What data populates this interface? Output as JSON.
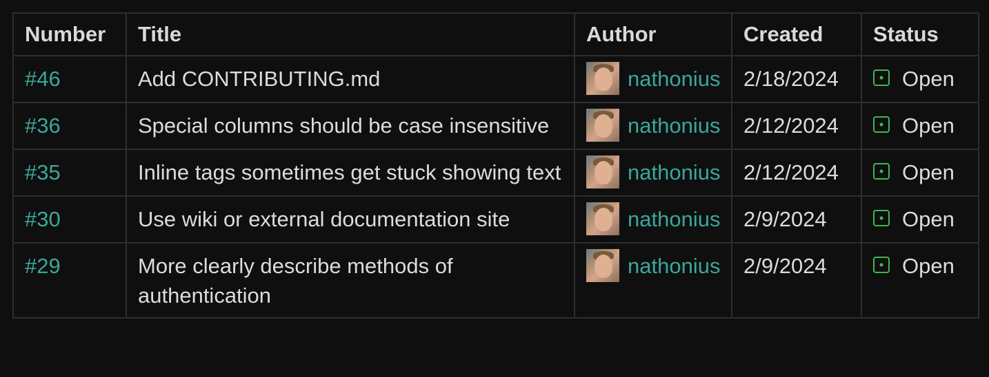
{
  "columns": [
    "Number",
    "Title",
    "Author",
    "Created",
    "Status"
  ],
  "rows": [
    {
      "number": "#46",
      "title": "Add CONTRIBUTING.md",
      "author": "nathonius",
      "created": "2/18/2024",
      "status": "Open"
    },
    {
      "number": "#36",
      "title": "Special columns should be case insensitive",
      "author": "nathonius",
      "created": "2/12/2024",
      "status": "Open"
    },
    {
      "number": "#35",
      "title": "Inline tags sometimes get stuck showing text",
      "author": "nathonius",
      "created": "2/12/2024",
      "status": "Open"
    },
    {
      "number": "#30",
      "title": "Use wiki or external documentation site",
      "author": "nathonius",
      "created": "2/9/2024",
      "status": "Open"
    },
    {
      "number": "#29",
      "title": "More clearly describe methods of authentication",
      "author": "nathonius",
      "created": "2/9/2024",
      "status": "Open"
    }
  ],
  "icons": {
    "status": "issue-open-icon",
    "avatar": "avatar"
  },
  "colors": {
    "background": "#0f0f0f",
    "link": "#3aa79a",
    "open_status": "#3fb950",
    "border": "#2e2e2e",
    "text": "#dcdcdc"
  }
}
